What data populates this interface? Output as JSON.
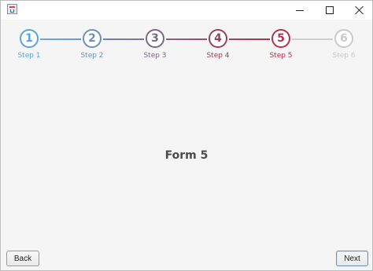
{
  "window": {
    "title": "",
    "controls": {
      "minimize": "minimize",
      "maximize": "maximize",
      "close": "close"
    }
  },
  "stepper": {
    "steps": [
      {
        "number": "1",
        "label": "Step 1",
        "color": "#58a4d7",
        "state": "completed"
      },
      {
        "number": "2",
        "label": "Step 2",
        "color": "#6d8fb8",
        "state": "completed"
      },
      {
        "number": "3",
        "label": "Step 3",
        "color": "#7b6787",
        "state": "completed"
      },
      {
        "number": "4",
        "label": "Step 4",
        "color": "#9a4055",
        "state": "completed"
      },
      {
        "number": "5",
        "label": "Step 5",
        "color": "#b1314c",
        "state": "current"
      },
      {
        "number": "6",
        "label": "Step 6",
        "color": "#c9c9c9",
        "state": "upcoming"
      }
    ]
  },
  "main": {
    "form_title": "Form 5"
  },
  "footer": {
    "back_label": "Back",
    "next_label": "Next"
  }
}
